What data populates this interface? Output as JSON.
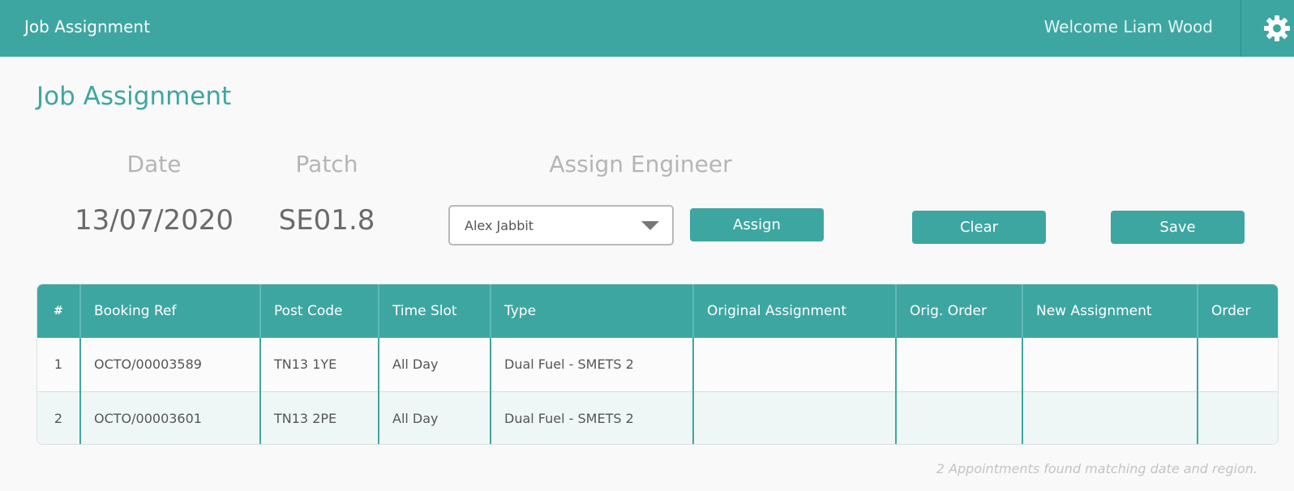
{
  "header": {
    "app_title": "Job Assignment",
    "welcome": "Welcome Liam Wood",
    "settings_icon": "gear-icon"
  },
  "page": {
    "title": "Job Assignment"
  },
  "form": {
    "date_label": "Date",
    "date_value": "13/07/2020",
    "patch_label": "Patch",
    "patch_value": "SE01.8",
    "engineer_label": "Assign Engineer",
    "engineer_selected": "Alex Jabbit",
    "assign_label": "Assign",
    "clear_label": "Clear",
    "save_label": "Save"
  },
  "table": {
    "columns": [
      "#",
      "Booking Ref",
      "Post Code",
      "Time Slot",
      "Type",
      "Original Assignment",
      "Orig. Order",
      "New Assignment",
      "Order"
    ],
    "rows": [
      [
        "1",
        "OCTO/00003589",
        "TN13 1YE",
        "All Day",
        "Dual Fuel - SMETS 2",
        "",
        "",
        "",
        ""
      ],
      [
        "2",
        "OCTO/00003601",
        "TN13 2PE",
        "All Day",
        "Dual Fuel - SMETS 2",
        "",
        "",
        "",
        ""
      ]
    ]
  },
  "footer": {
    "status": "2 Appointments found matching date and region."
  },
  "colors": {
    "accent": "#3ea6a1",
    "background": "#f9f9f9"
  }
}
